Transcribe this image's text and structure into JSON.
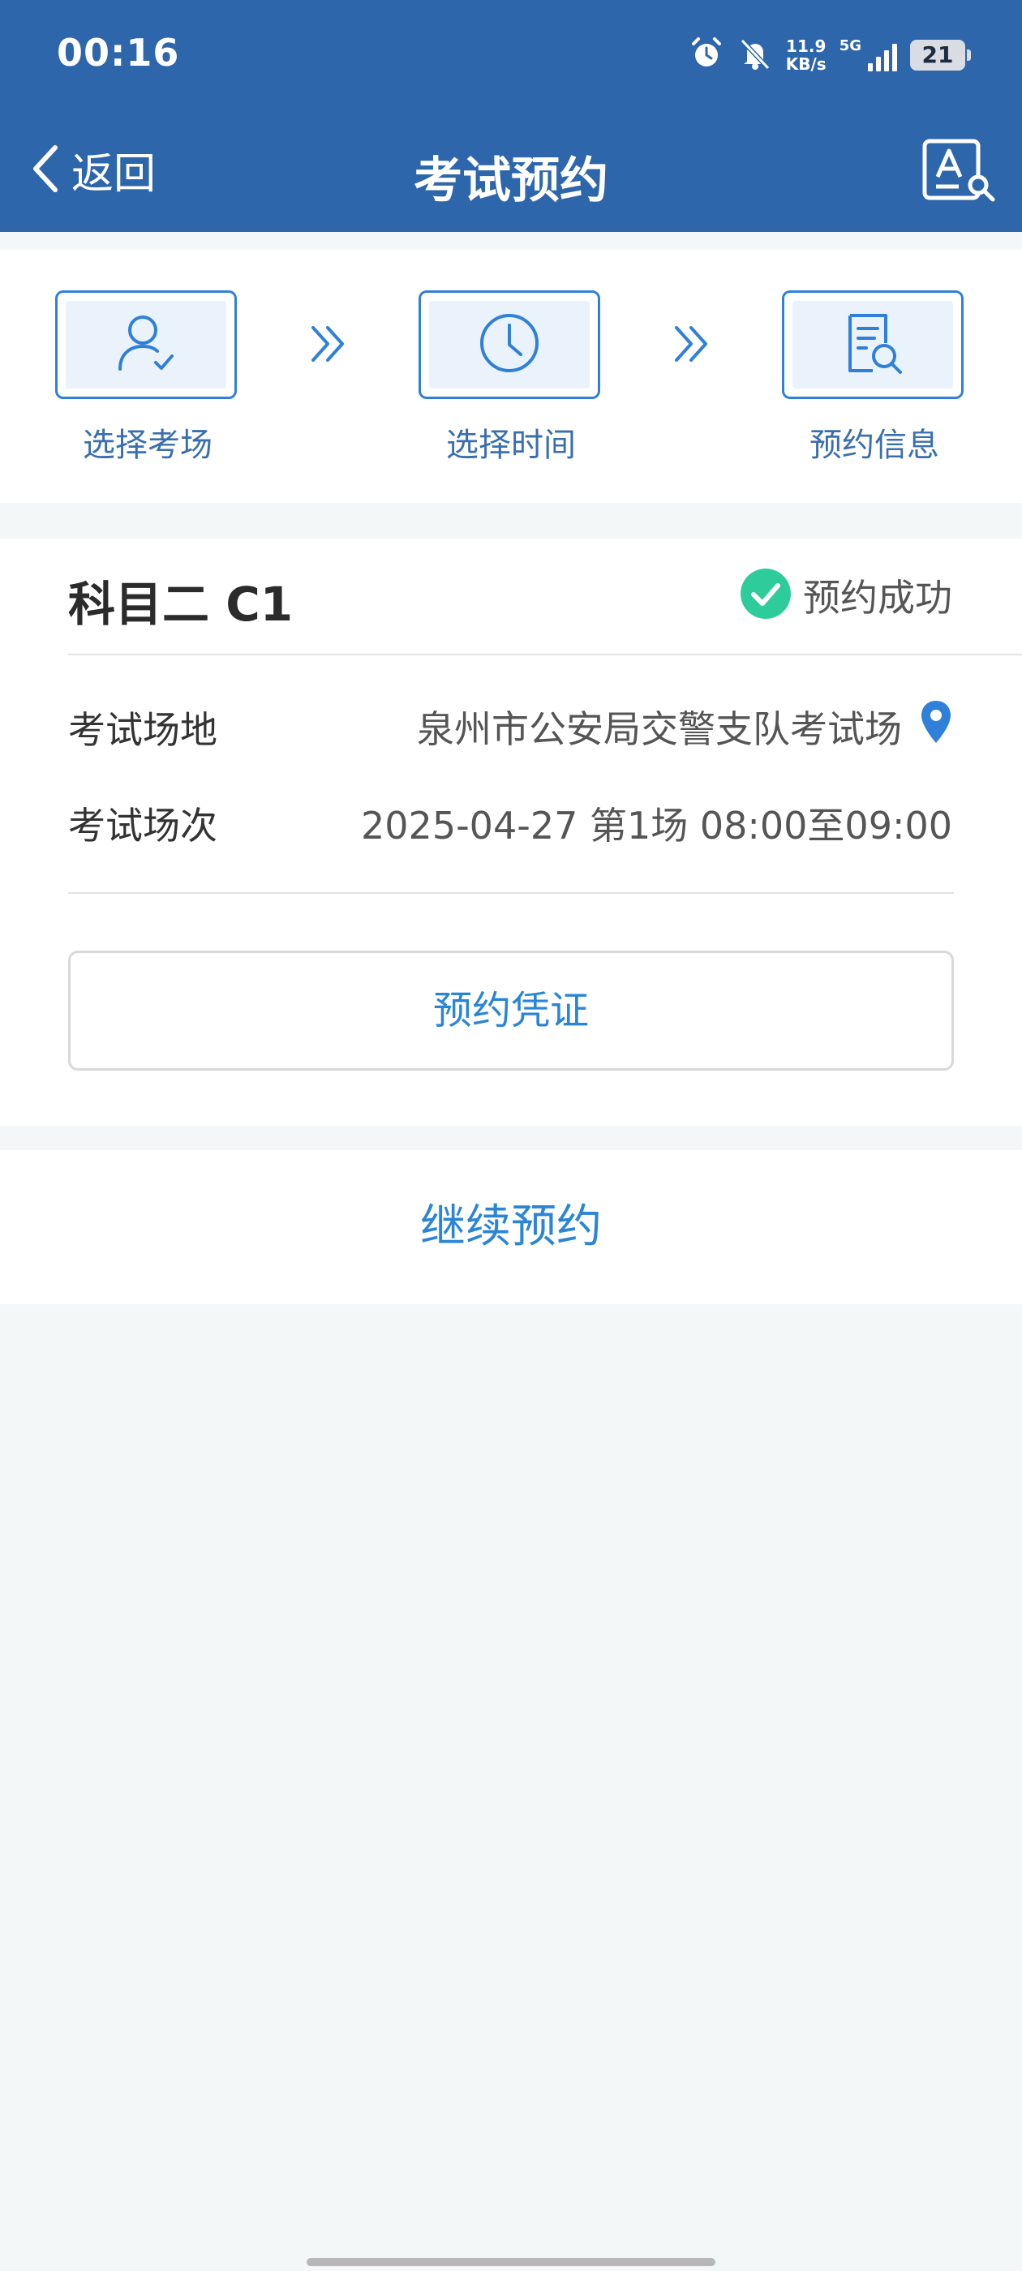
{
  "status_bar": {
    "time": "00:16",
    "net_speed_value": "11.9",
    "net_speed_unit": "KB/s",
    "network_type": "5G",
    "battery": "21"
  },
  "header": {
    "back_label": "返回",
    "title": "考试预约"
  },
  "steps": [
    {
      "label": "选择考场",
      "icon": "user-check-icon"
    },
    {
      "label": "选择时间",
      "icon": "clock-icon"
    },
    {
      "label": "预约信息",
      "icon": "document-search-icon"
    }
  ],
  "booking": {
    "subject": "科目二 C1",
    "status": "预约成功",
    "venue_label": "考试场地",
    "venue_value": "泉州市公安局交警支队考试场",
    "session_label": "考试场次",
    "session_value": "2025-04-27 第1场 08:00至09:00",
    "voucher_button": "预约凭证"
  },
  "continue_label": "继续预约",
  "colors": {
    "header_bg": "#2e66ab",
    "accent": "#2b85d6",
    "success": "#2ecc9a"
  }
}
